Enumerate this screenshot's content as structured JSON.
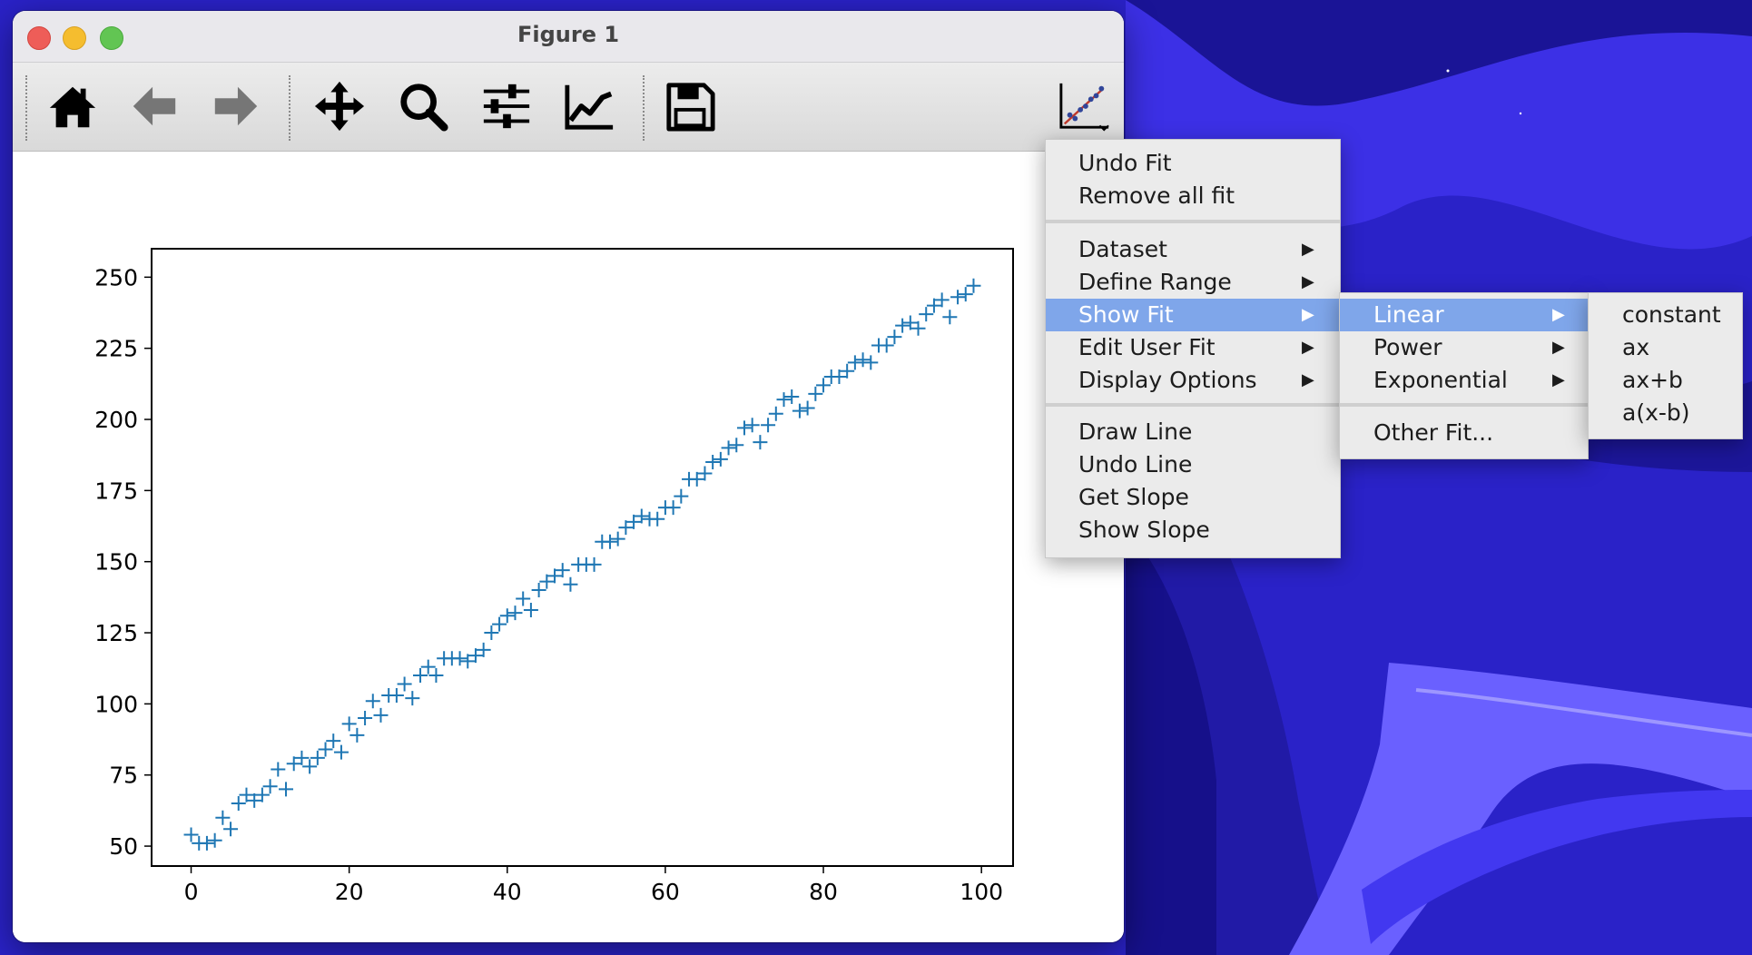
{
  "window": {
    "title": "Figure 1"
  },
  "toolbar": {
    "buttons": [
      {
        "name": "home-button",
        "icon": "home-icon"
      },
      {
        "name": "back-button",
        "icon": "arrow-left-icon"
      },
      {
        "name": "forward-button",
        "icon": "arrow-right-icon"
      },
      {
        "name": "pan-button",
        "icon": "move-arrows-icon"
      },
      {
        "name": "zoom-button",
        "icon": "magnifier-icon"
      },
      {
        "name": "subplots-button",
        "icon": "sliders-icon"
      },
      {
        "name": "edit-axes-button",
        "icon": "line-chart-icon"
      },
      {
        "name": "save-button",
        "icon": "floppy-disk-icon"
      },
      {
        "name": "fit-menu-button",
        "icon": "scatter-fit-icon"
      }
    ]
  },
  "menu": {
    "items": [
      "Undo Fit",
      "Remove all fit",
      "Dataset",
      "Define Range",
      "Show Fit",
      "Edit User Fit",
      "Display Options",
      "Draw Line",
      "Undo Line",
      "Get Slope",
      "Show Slope"
    ],
    "submenu_arrow": "▶"
  },
  "submenu": {
    "items": [
      "Linear",
      "Power",
      "Exponential",
      "Other Fit..."
    ]
  },
  "subsubmenu": {
    "items": [
      "constant",
      "ax",
      "ax+b",
      "a(x-b)"
    ]
  },
  "colors": {
    "accent": "#7fa6ea",
    "series": "#1f77b4",
    "desktop": "#2a22c8"
  },
  "chart_data": {
    "type": "scatter",
    "marker": "+",
    "xlim": [
      -5,
      104
    ],
    "ylim": [
      43,
      260
    ],
    "xticks": [
      0,
      20,
      40,
      60,
      80,
      100
    ],
    "yticks": [
      50,
      75,
      100,
      125,
      150,
      175,
      200,
      225,
      250
    ],
    "series": [
      {
        "x": [
          0,
          1,
          2,
          3,
          4,
          5,
          6,
          7,
          8,
          9,
          10,
          11,
          12,
          13,
          14,
          15,
          16,
          17,
          18,
          19,
          20,
          21,
          22,
          23,
          24,
          25,
          26,
          27,
          28,
          29,
          30,
          31,
          32,
          33,
          34,
          35,
          36,
          37,
          38,
          39,
          40,
          41,
          42,
          43,
          44,
          45,
          46,
          47,
          48,
          49,
          50,
          51,
          52,
          53,
          54,
          55,
          56,
          57,
          58,
          59,
          60,
          61,
          62,
          63,
          64,
          65,
          66,
          67,
          68,
          69,
          70,
          71,
          72,
          73,
          74,
          75,
          76,
          77,
          78,
          79,
          80,
          81,
          82,
          83,
          84,
          85,
          86,
          87,
          88,
          89,
          90,
          91,
          92,
          93,
          94,
          95,
          96,
          97,
          98,
          99
        ],
        "y": [
          54,
          51,
          51,
          52,
          60,
          56,
          65,
          68,
          66,
          68,
          71,
          77,
          70,
          79,
          81,
          78,
          81,
          84,
          87,
          83,
          93,
          89,
          95,
          101,
          96,
          103,
          103,
          107,
          102,
          110,
          113,
          110,
          116,
          116,
          116,
          115,
          117,
          119,
          125,
          128,
          131,
          132,
          137,
          133,
          140,
          143,
          145,
          147,
          142,
          149,
          149,
          149,
          157,
          157,
          158,
          162,
          164,
          166,
          165,
          165,
          169,
          169,
          173,
          179,
          179,
          181,
          185,
          186,
          190,
          191,
          197,
          198,
          192,
          198,
          202,
          207,
          208,
          203,
          204,
          209,
          212,
          215,
          215,
          217,
          220,
          221,
          220,
          226,
          226,
          229,
          233,
          234,
          232,
          237,
          240,
          242,
          236,
          243,
          244,
          247
        ]
      }
    ]
  }
}
